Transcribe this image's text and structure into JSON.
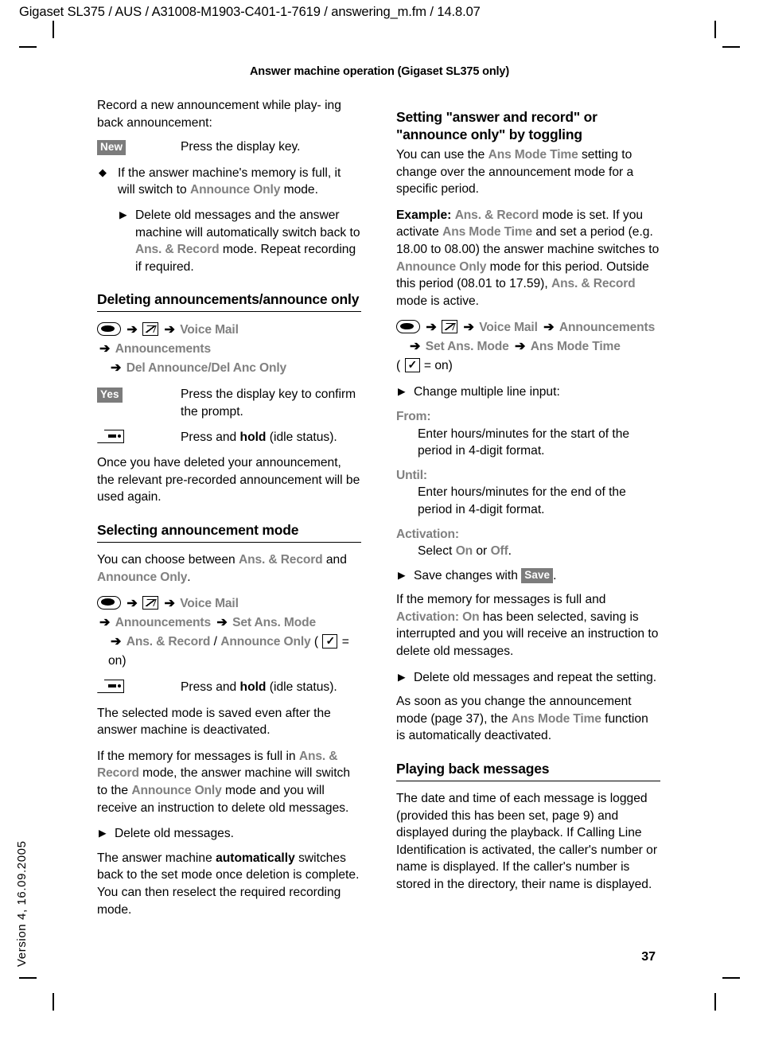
{
  "header": {
    "running_head": "Gigaset SL375 / AUS / A31008-M1903-C401-1-7619 / answering_m.fm / 14.8.07",
    "page_title": "Answer machine operation (Gigaset SL375 only)"
  },
  "footer": {
    "version": "Version 4, 16.09.2005",
    "page_number": "37"
  },
  "left_column": {
    "intro": {
      "line1": "Record a new announcement while play-",
      "line2": "ing back announcement:"
    },
    "new_key": {
      "badge": "New",
      "description": "Press the display key."
    },
    "diamond_item": {
      "text_before": "If the answer machine's memory is full, it will switch to ",
      "term": "Announce Only",
      "text_after": " mode."
    },
    "sub_item": {
      "text_before": "Delete old messages and the answer machine will automatically switch back to ",
      "term": "Ans. & Record",
      "text_after": " mode. Repeat recording if required."
    },
    "section_delete": {
      "heading": "Deleting announcements/announce only",
      "path": {
        "line1_item": "Voice Mail",
        "line2_item": "Announcements",
        "line3_item": "Del Announce/Del Anc Only"
      },
      "yes_key": {
        "badge": "Yes",
        "description": "Press the display key to confirm the prompt."
      },
      "end_key": {
        "desc_before": "Press and ",
        "desc_bold": "hold",
        "desc_after": " (idle status)."
      },
      "note": "Once you have deleted your announcement, the relevant pre-recorded announcement will be used again."
    },
    "section_select": {
      "heading": "Selecting announcement mode",
      "intro_before": "You can choose between ",
      "intro_term1": "Ans. & Record",
      "intro_middle": " and ",
      "intro_term2": "Announce Only",
      "intro_after": ".",
      "path": {
        "line1_item": "Voice Mail",
        "line2_item1": "Announcements",
        "line2_item2": "Set Ans. Mode",
        "line3_item1": "Ans. & Record",
        "line3_sep": " / ",
        "line3_item2": "Announce Only",
        "line3_open": " (",
        "line3_on": " = on)"
      },
      "end_key": {
        "desc_before": "Press and ",
        "desc_bold": "hold",
        "desc_after": " (idle status)."
      },
      "para_saved": "The selected mode is saved even after the answer machine is deactivated.",
      "para_full": {
        "before": "If the memory for messages is full in ",
        "term1": "Ans. & Record",
        "middle": " mode, the answer machine will switch to the ",
        "term2": "Announce Only",
        "after": " mode and you will receive an instruction to delete old messages."
      },
      "delete_item": "Delete old messages.",
      "para_auto": {
        "before": "The answer machine ",
        "bold": "automatically",
        "after": " switches back to the set mode once deletion is complete. You can then reselect the required recording mode."
      }
    }
  },
  "right_column": {
    "section_toggle": {
      "heading": "Setting \"answer and record\" or \"announce only\" by toggling",
      "intro_before": "You can use the ",
      "intro_term": "Ans Mode Time",
      "intro_after": " setting to change over the announcement mode for a specific period.",
      "example": {
        "label": "Example:",
        "term1": "Ans. & Record",
        "t1_after": " mode is set. If you activate ",
        "term2": "Ans Mode Time",
        "t2_after": " and set a period (e.g. 18.00 to 08.00) the answer machine switches to ",
        "term3": "Announce Only",
        "t3_after": " mode for this period. Outside this period (08.01 to 17.59), ",
        "term4": "Ans. & Record",
        "t4_after": " mode is active."
      },
      "path": {
        "line1_item1": "Voice Mail",
        "line1_item2": "Announcements",
        "line2_item1": "Set Ans. Mode",
        "line2_item2": "Ans Mode Time",
        "line3_open": "(",
        "line3_on": " = on)"
      },
      "change_item": "Change multiple line input:",
      "from": {
        "label": "From:",
        "body": "Enter hours/minutes for the start of the period in 4-digit format."
      },
      "until": {
        "label": "Until:",
        "body": "Enter hours/minutes for the end of the period in 4-digit format."
      },
      "activation": {
        "label": "Activation:",
        "body_before": "Select ",
        "term_on": "On",
        "body_middle": " or ",
        "term_off": "Off",
        "body_after": "."
      },
      "save_item": {
        "before": "Save changes with ",
        "badge": "Save",
        "after": "."
      },
      "para_memory": {
        "before": "If the memory for messages is full and ",
        "term": "Activation: On",
        "after": " has been selected, saving is interrupted and you will receive an instruction to delete old messages."
      },
      "delete_item": "Delete old messages and repeat the setting.",
      "para_change": {
        "before": "As soon as you change the announcement mode (page 37), the ",
        "term": "Ans Mode Time",
        "after": " function is automatically deactivated."
      }
    },
    "section_playback": {
      "heading": "Playing back messages",
      "body": "The date and time of each message is logged (provided this has been set, page 9) and displayed during the playback. If Calling Line Identification is activated, the caller's number or name is displayed. If the caller's number is stored in the directory, their name is displayed."
    }
  },
  "icons": {
    "menu_key": "control-key-icon",
    "message_key": "voice-mail-key-icon",
    "end_key": "end-call-key-icon",
    "checkbox": "checkbox-checked-icon",
    "arrow": "➔"
  },
  "colors": {
    "menu_term": "#808080",
    "badge_bg": "#7c7c7c",
    "text": "#000000"
  }
}
